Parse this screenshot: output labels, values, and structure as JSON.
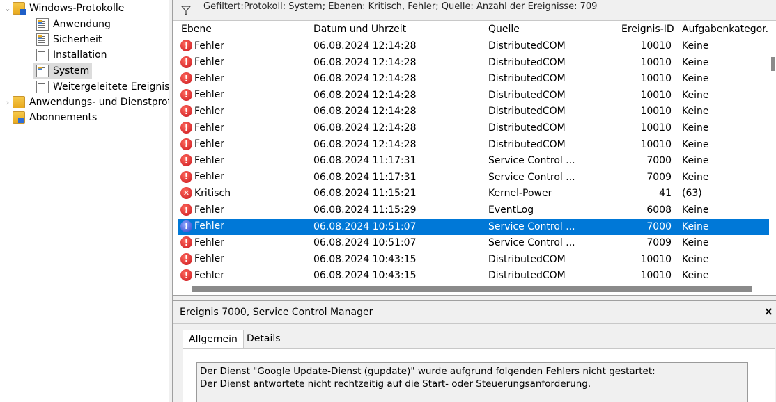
{
  "tree": {
    "items": [
      {
        "label": "Windows-Protokolle",
        "chevron": "⌄",
        "icon": "windows-logs-icon"
      },
      {
        "label": "Anwendung",
        "icon": "event-log-icon"
      },
      {
        "label": "Sicherheit",
        "icon": "event-log-icon"
      },
      {
        "label": "Installation",
        "icon": "event-log-icon"
      },
      {
        "label": "System",
        "icon": "event-log-icon"
      },
      {
        "label": "Weitergeleitete Ereignisse",
        "icon": "event-log-icon"
      },
      {
        "label": "Anwendungs- und Dienstprotokolle",
        "chevron": "›",
        "icon": "folder-icon"
      },
      {
        "label": "Abonnements",
        "icon": "subscription-icon"
      }
    ]
  },
  "filterbar": {
    "text": "Gefiltert:Protokoll: System; Ebenen: Kritisch, Fehler; Quelle: Anzahl der Ereignisse: 709"
  },
  "grid": {
    "headers": {
      "level": "Ebene",
      "datetime": "Datum und Uhrzeit",
      "source": "Quelle",
      "event_id": "Ereignis-ID",
      "category": "Aufgabenkategor..."
    },
    "rows": [
      {
        "level": "Fehler",
        "kind": "error",
        "datetime": "06.08.2024 12:14:28",
        "source": "DistributedCOM",
        "event_id": "10010",
        "category": "Keine"
      },
      {
        "level": "Fehler",
        "kind": "error",
        "datetime": "06.08.2024 12:14:28",
        "source": "DistributedCOM",
        "event_id": "10010",
        "category": "Keine"
      },
      {
        "level": "Fehler",
        "kind": "error",
        "datetime": "06.08.2024 12:14:28",
        "source": "DistributedCOM",
        "event_id": "10010",
        "category": "Keine"
      },
      {
        "level": "Fehler",
        "kind": "error",
        "datetime": "06.08.2024 12:14:28",
        "source": "DistributedCOM",
        "event_id": "10010",
        "category": "Keine"
      },
      {
        "level": "Fehler",
        "kind": "error",
        "datetime": "06.08.2024 12:14:28",
        "source": "DistributedCOM",
        "event_id": "10010",
        "category": "Keine"
      },
      {
        "level": "Fehler",
        "kind": "error",
        "datetime": "06.08.2024 12:14:28",
        "source": "DistributedCOM",
        "event_id": "10010",
        "category": "Keine"
      },
      {
        "level": "Fehler",
        "kind": "error",
        "datetime": "06.08.2024 12:14:28",
        "source": "DistributedCOM",
        "event_id": "10010",
        "category": "Keine"
      },
      {
        "level": "Fehler",
        "kind": "error",
        "datetime": "06.08.2024 11:17:31",
        "source": "Service Control ...",
        "event_id": "7000",
        "category": "Keine"
      },
      {
        "level": "Fehler",
        "kind": "error",
        "datetime": "06.08.2024 11:17:31",
        "source": "Service Control ...",
        "event_id": "7009",
        "category": "Keine"
      },
      {
        "level": "Kritisch",
        "kind": "critical",
        "datetime": "06.08.2024 11:15:21",
        "source": "Kernel-Power",
        "event_id": "41",
        "category": "(63)"
      },
      {
        "level": "Fehler",
        "kind": "error",
        "datetime": "06.08.2024 11:15:29",
        "source": "EventLog",
        "event_id": "6008",
        "category": "Keine"
      },
      {
        "level": "Fehler",
        "kind": "error",
        "datetime": "06.08.2024 10:51:07",
        "source": "Service Control ...",
        "event_id": "7000",
        "category": "Keine",
        "selected": true
      },
      {
        "level": "Fehler",
        "kind": "error",
        "datetime": "06.08.2024 10:51:07",
        "source": "Service Control ...",
        "event_id": "7009",
        "category": "Keine"
      },
      {
        "level": "Fehler",
        "kind": "error",
        "datetime": "06.08.2024 10:43:15",
        "source": "DistributedCOM",
        "event_id": "10010",
        "category": "Keine"
      },
      {
        "level": "Fehler",
        "kind": "error",
        "datetime": "06.08.2024 10:43:15",
        "source": "DistributedCOM",
        "event_id": "10010",
        "category": "Keine"
      }
    ]
  },
  "detail": {
    "title": "Ereignis 7000, Service Control Manager",
    "close": "×",
    "tabs": [
      "Allgemein",
      "Details"
    ],
    "message_line1": "Der Dienst \"Google Update-Dienst (gupdate)\" wurde aufgrund folgenden Fehlers nicht gestartet:",
    "message_line2": "Der Dienst antwortete nicht rechtzeitig auf die Start- oder Steuerungsanforderung."
  }
}
